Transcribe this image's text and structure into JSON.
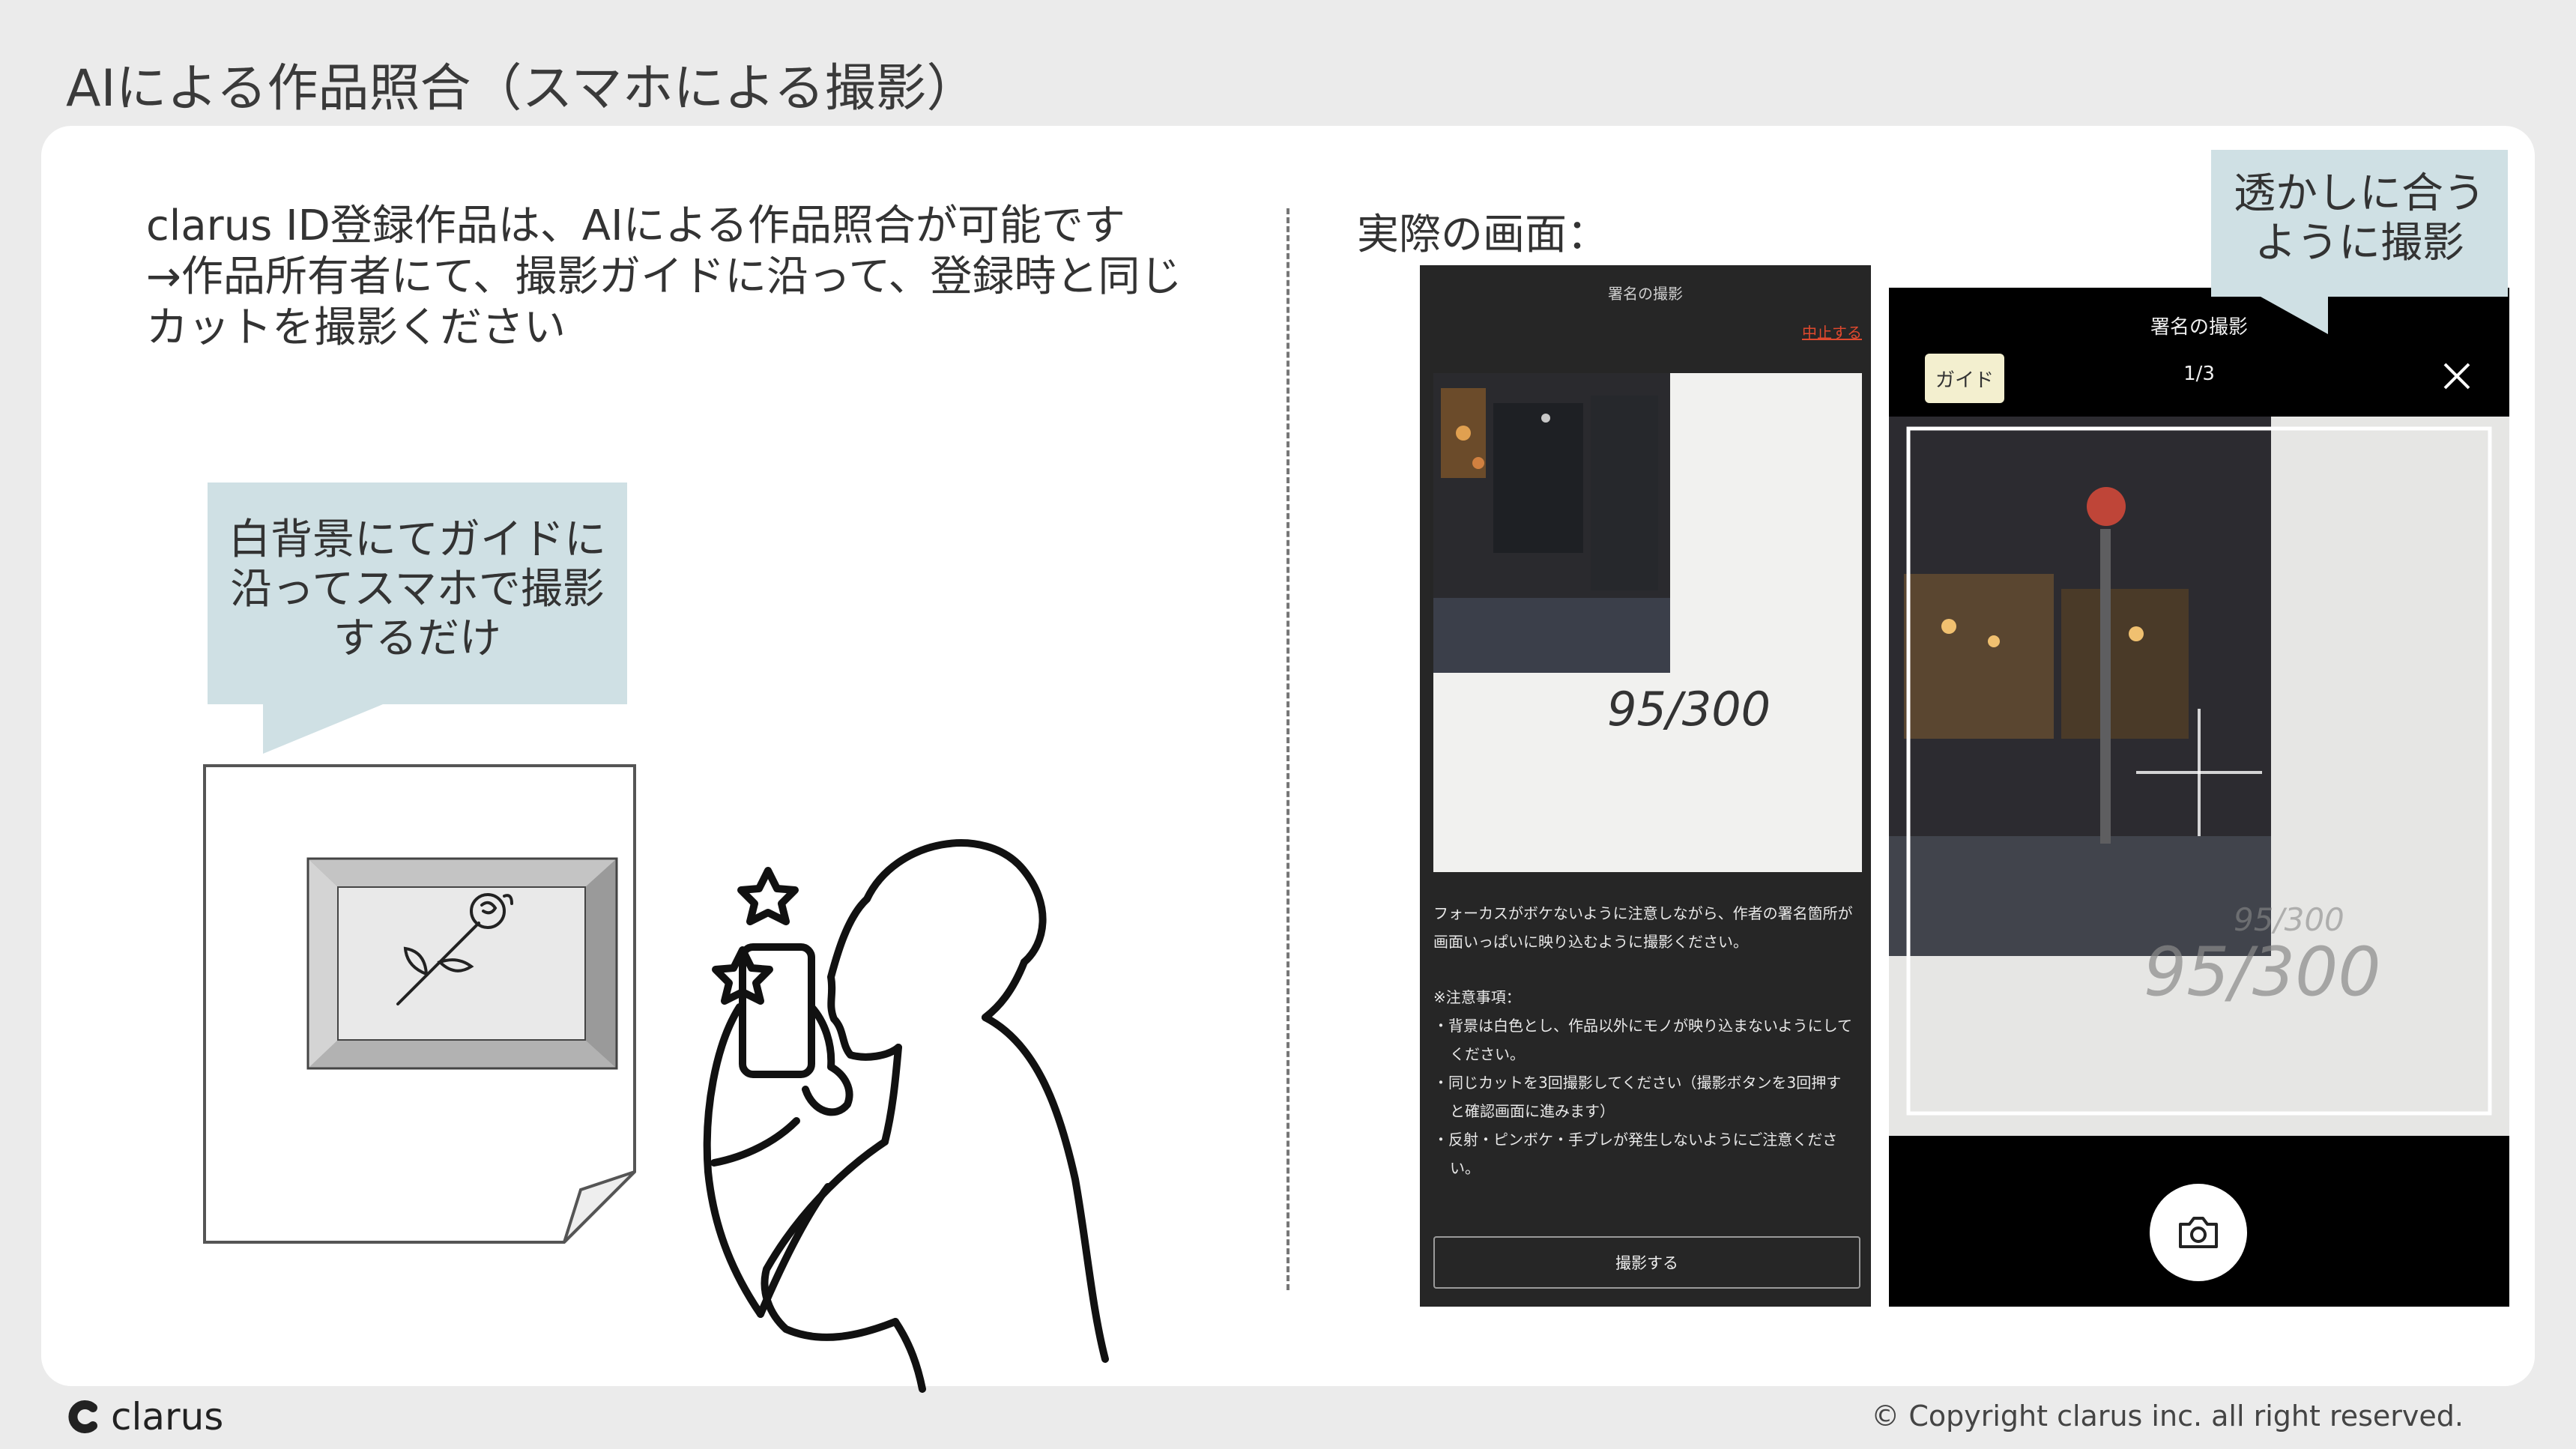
{
  "slide": {
    "title": "AIによる作品照合（スマホによる撮影）"
  },
  "description": {
    "line1": "clarus ID登録作品は、AIによる作品照合が可能です",
    "line2": "→作品所有者にて、撮影ガイドに沿って、登録時と同じ",
    "line3": "カットを撮影ください"
  },
  "left_bubble": {
    "line1": "白背景にてガイドに",
    "line2": "沿ってスマホで撮影",
    "line3": "するだけ"
  },
  "screen_label": "実際の画面：",
  "phone_a": {
    "header": "署名の撮影",
    "stop_link": "中止する",
    "signature": "95/300",
    "instruction1": "フォーカスがボケないように注意しながら、作者の署名箇所が",
    "instruction2": "画面いっぱいに映り込むように撮影ください。",
    "notes_title": "※注意事項：",
    "note1a": "・背景は白色とし、作品以外にモノが映り込まないようにして",
    "note1b": "ください。",
    "note2a": "・同じカットを3回撮影してください（撮影ボタンを3回押す",
    "note2b": "と確認画面に進みます）",
    "note3a": "・反射・ピンボケ・手ブレが発生しないようにご注意くださ",
    "note3b": "い。",
    "shoot_button": "撮影する"
  },
  "phone_b": {
    "header": "署名の撮影",
    "guide_button": "ガイド",
    "counter": "1/3",
    "signature": "95/300",
    "signature_ghost": "95/300"
  },
  "right_bubble": {
    "line1": "透かしに合う",
    "line2": "ように撮影"
  },
  "footer": {
    "logo_text": "clarus",
    "copyright": "© Copyright clarus inc. all right reserved."
  },
  "colors": {
    "bubble": "#cfe0e4",
    "background": "#ebebeb",
    "stop_link": "#e0492e"
  }
}
